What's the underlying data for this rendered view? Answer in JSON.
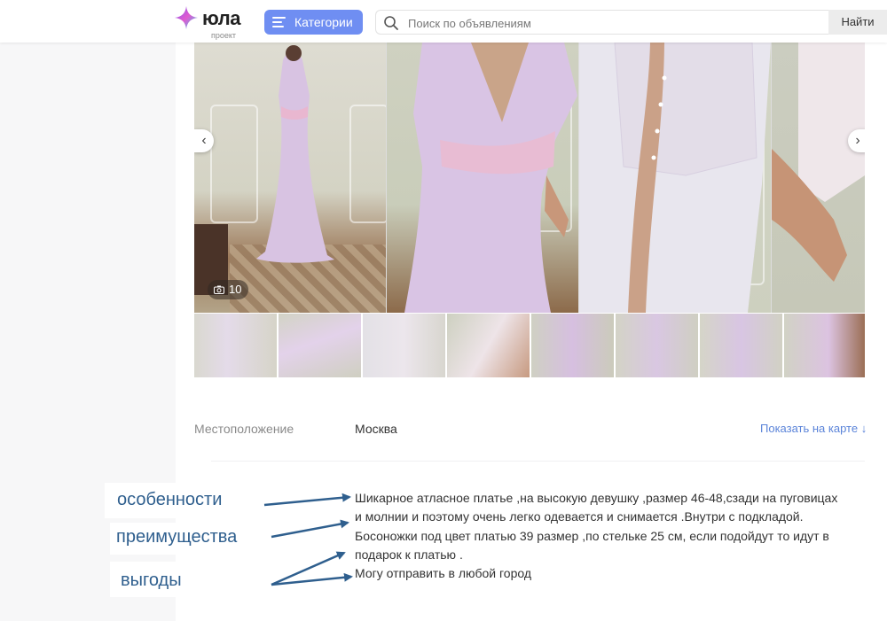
{
  "header": {
    "logo_text": "юла",
    "logo_sub": "проект",
    "categories_label": "Категории",
    "search_placeholder": "Поиск по объявлениям",
    "search_button": "Найти"
  },
  "gallery": {
    "photo_count": "10",
    "icons": {
      "prev": "chevron-left-icon",
      "next": "chevron-right-icon",
      "camera": "camera-icon"
    }
  },
  "location": {
    "label": "Местоположение",
    "value": "Москва",
    "map_link": "Показать на карте ↓"
  },
  "description": {
    "lines": [
      "Шикарное атласное платье ,на высокую девушку ,размер 46-48,сзади на пуговицах",
      "и молнии и поэтому очень легко одевается и снимается .Внутри с подкладой.",
      "Босоножки под цвет платью 39 размер ,по стельке 25 см, если подойдут то идут в",
      "подарок к платью .",
      "Могу отправить в любой город"
    ]
  },
  "annotations": {
    "features": "особенности",
    "advantages": "преимущества",
    "benefits": "выгоды",
    "color": "#2f5f8e"
  },
  "colors": {
    "accent": "#6f8ef2",
    "link": "#5b84d9",
    "dress": "#d9c6e4"
  }
}
